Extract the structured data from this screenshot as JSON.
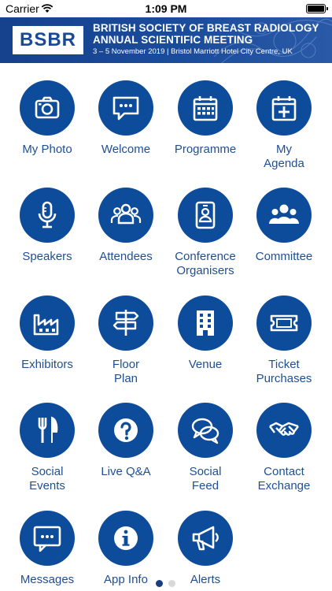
{
  "status_bar": {
    "carrier": "Carrier",
    "time": "1:09 PM",
    "battery_level": 1.0
  },
  "banner": {
    "logo_text": "BSBR",
    "title_line1": "BRITISH SOCIETY OF BREAST RADIOLOGY",
    "title_line2": "ANNUAL SCIENTIFIC MEETING",
    "date_location": "3 – 5 November 2019   |   Bristol Marriott Hotel City Centre, UK"
  },
  "colors": {
    "accent": "#0d4b9b",
    "label": "#1f4f93",
    "banner": "#1b4c9c"
  },
  "tiles": [
    {
      "label": "My Photo",
      "icon": "camera-icon"
    },
    {
      "label": "Welcome",
      "icon": "speech-bubble-icon"
    },
    {
      "label": "Programme",
      "icon": "calendar-icon"
    },
    {
      "label": "My\nAgenda",
      "icon": "calendar-add-icon"
    },
    {
      "label": "Speakers",
      "icon": "microphone-icon"
    },
    {
      "label": "Attendees",
      "icon": "people-group-icon"
    },
    {
      "label": "Conference\nOrganisers",
      "icon": "id-badge-icon"
    },
    {
      "label": "Committee",
      "icon": "team-icon"
    },
    {
      "label": "Exhibitors",
      "icon": "factory-icon"
    },
    {
      "label": "Floor\nPlan",
      "icon": "signpost-icon"
    },
    {
      "label": "Venue",
      "icon": "building-icon"
    },
    {
      "label": "Ticket\nPurchases",
      "icon": "ticket-icon"
    },
    {
      "label": "Social\nEvents",
      "icon": "cutlery-icon"
    },
    {
      "label": "Live Q&A",
      "icon": "question-icon"
    },
    {
      "label": "Social\nFeed",
      "icon": "chat-bubbles-icon"
    },
    {
      "label": "Contact\nExchange",
      "icon": "handshake-icon"
    },
    {
      "label": "Messages",
      "icon": "message-icon"
    },
    {
      "label": "App Info",
      "icon": "info-icon"
    },
    {
      "label": "Alerts",
      "icon": "megaphone-icon"
    }
  ],
  "pager": {
    "pages": 2,
    "current": 1
  }
}
